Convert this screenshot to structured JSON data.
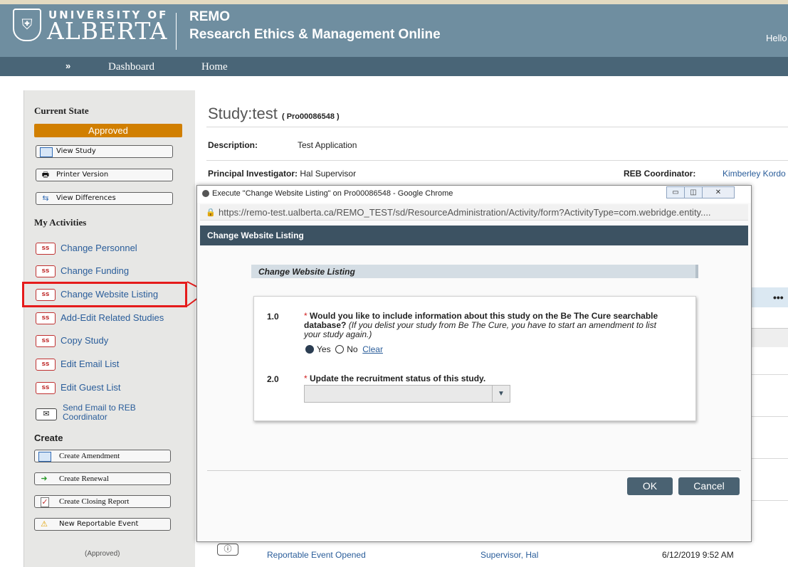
{
  "header": {
    "univ_line1": "UNIVERSITY OF",
    "univ_line2": "ALBERTA",
    "app_name": "REMO",
    "app_full_name": "Research Ethics & Management Online",
    "greeting": "Hello"
  },
  "nav": {
    "expand": "»",
    "dashboard": "Dashboard",
    "home": "Home"
  },
  "sidebar": {
    "current_state_title": "Current State",
    "state": "Approved",
    "buttons": [
      {
        "label": "View Study",
        "icon": "window-icon"
      },
      {
        "label": "Printer Version",
        "icon": "printer-icon"
      },
      {
        "label": "View Differences",
        "icon": "differences-icon"
      }
    ],
    "my_activities_title": "My Activities",
    "activities": [
      {
        "badge": "ss",
        "label": "Change Personnel"
      },
      {
        "badge": "ss",
        "label": "Change Funding"
      },
      {
        "badge": "ss",
        "label": "Change Website Listing"
      },
      {
        "badge": "ss",
        "label": "Add-Edit Related Studies"
      },
      {
        "badge": "ss",
        "label": "Copy Study"
      },
      {
        "badge": "ss",
        "label": "Edit Email List"
      },
      {
        "badge": "ss",
        "label": "Edit Guest List"
      }
    ],
    "send_email_line1": "Send Email to REB",
    "send_email_line2": "Coordinator",
    "create_title": "Create",
    "create_buttons": [
      {
        "label": "Create Amendment",
        "icon": "window-icon"
      },
      {
        "label": "Create Renewal",
        "icon": "arrow-right-icon"
      },
      {
        "label": "Create Closing Report",
        "icon": "checklist-icon"
      },
      {
        "label": "New Reportable Event",
        "icon": "warning-icon"
      }
    ],
    "footer_state": "(Approved)"
  },
  "study": {
    "title_prefix": "Study:test",
    "id": "( Pro00086548 )",
    "description_label": "Description:",
    "description_value": "Test Application",
    "pi_label": "Principal Investigator:",
    "pi_value": "Hal Supervisor",
    "reb_label": "REB Coordinator:",
    "reb_value": "Kimberley Kordo"
  },
  "history_row": {
    "activity": "Reportable Event Opened",
    "author": "Supervisor, Hal",
    "date": "6/12/2019 9:52 AM"
  },
  "dialog": {
    "window_title": "Execute \"Change Website Listing\" on Pro00086548 - Google Chrome",
    "url": "https://remo-test.ualberta.ca/REMO_TEST/sd/ResourceAdministration/Activity/form?ActivityType=com.webridge.entity....",
    "heading": "Change Website Listing",
    "section_title": "Change Website Listing",
    "q1_num": "1.0",
    "q1_required": "*",
    "q1_text": "Would you like to include information about this study on the Be The Cure searchable database?",
    "q1_note": "(If you delist your study from Be The Cure, you have to start an amendment to list your study again.)",
    "q1_yes": "Yes",
    "q1_no": "No",
    "q1_clear": "Clear",
    "q1_selected": "Yes",
    "q2_num": "2.0",
    "q2_required": "*",
    "q2_text": "Update the recruitment status of this study.",
    "q2_value": "",
    "ok": "OK",
    "cancel": "Cancel"
  },
  "colors": {
    "header_bg": "#6f8ea0",
    "nav_bg": "#496577",
    "state_badge": "#d17f00",
    "dialog_head": "#3c5262",
    "highlight": "#e51b1b",
    "link": "#2a5d9a"
  }
}
